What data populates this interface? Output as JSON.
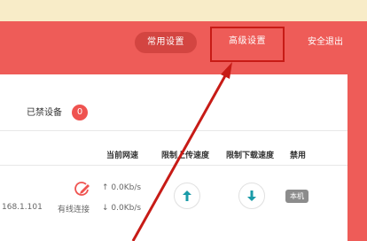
{
  "nav": {
    "common_settings": "常用设置",
    "advanced_settings": "高级设置",
    "logout": "安全退出"
  },
  "devices": {
    "blocked_label": "已禁设备",
    "blocked_count": "0"
  },
  "table": {
    "headers": [
      "当前网速",
      "限制上传速度",
      "限制下载速度",
      "禁用"
    ],
    "row": {
      "ip": "168.1.101",
      "connection": "有线连接",
      "upload_speed": "0.0Kb/s",
      "download_speed": "0.0Kb/s",
      "local_tag": "本机"
    }
  },
  "colors": {
    "accent_red": "#ee5c58",
    "annotation_red": "#c71b16",
    "teal": "#1a9ba8"
  }
}
